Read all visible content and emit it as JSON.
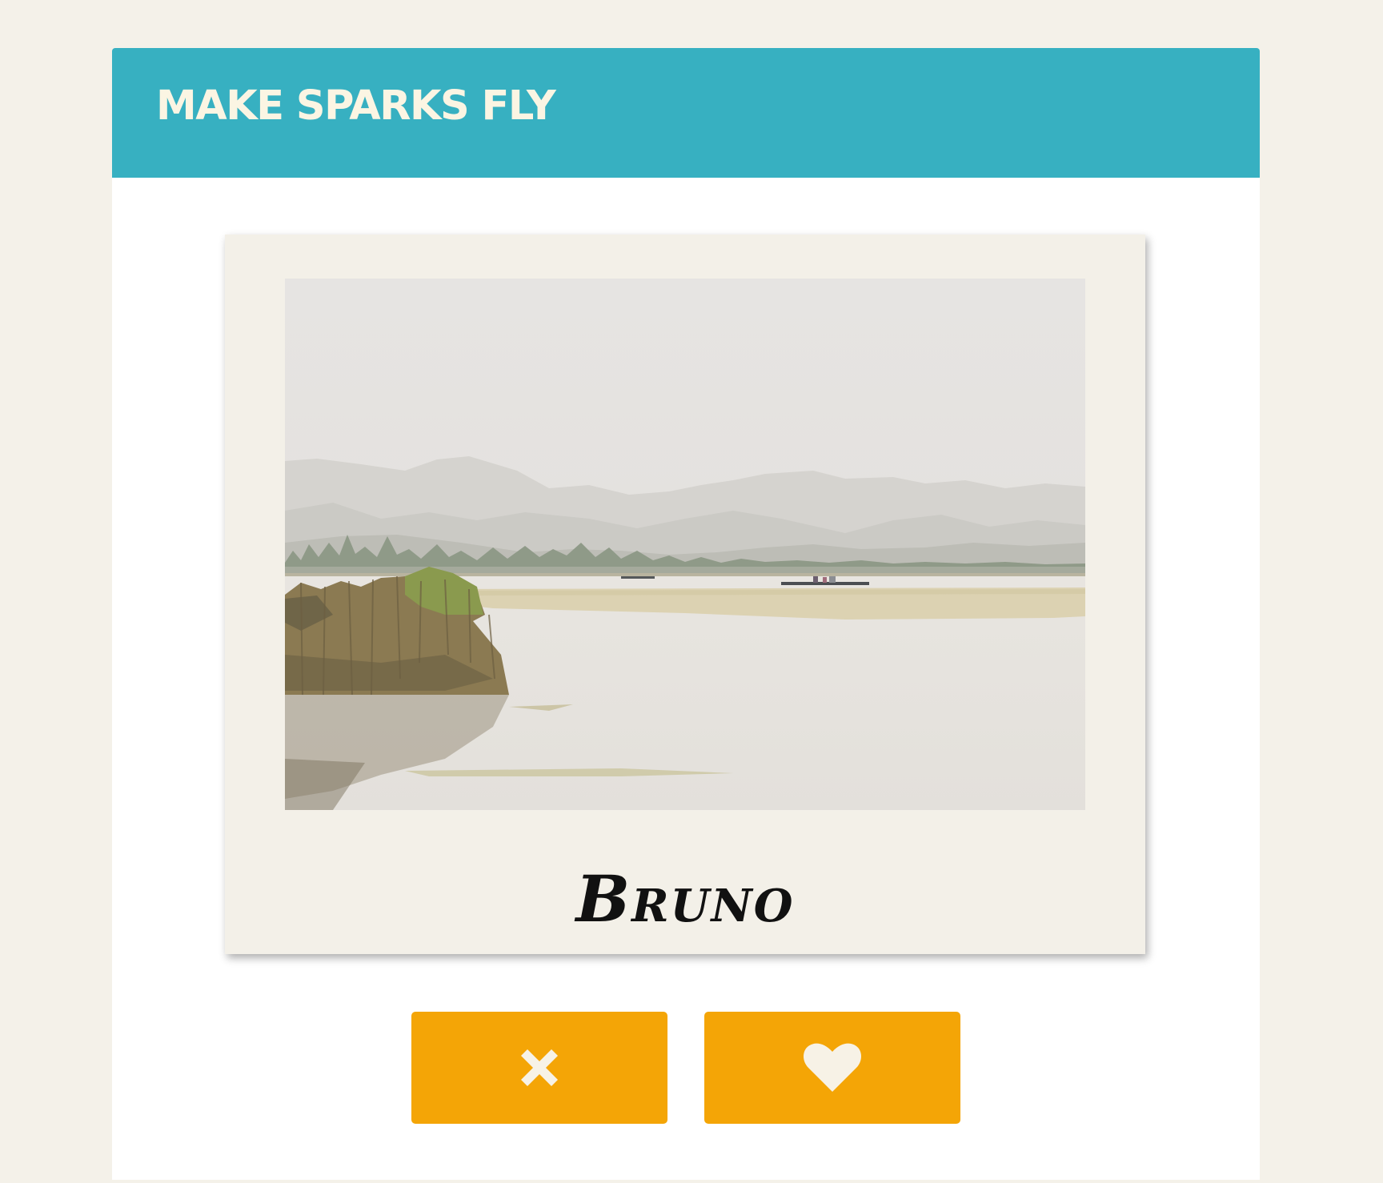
{
  "header": {
    "title": "MAKE SPARKS FLY"
  },
  "profile": {
    "name": "Bruno",
    "photo_icon": "lake-landscape-photo"
  },
  "actions": {
    "reject_icon": "close-icon",
    "like_icon": "heart-icon"
  },
  "colors": {
    "page_background": "#f4f1e9",
    "header_background": "#37b0c1",
    "header_text": "#fbf5e3",
    "card_background": "#f3f0e8",
    "button_background": "#f4a506",
    "button_icon": "#f7f2e6"
  }
}
